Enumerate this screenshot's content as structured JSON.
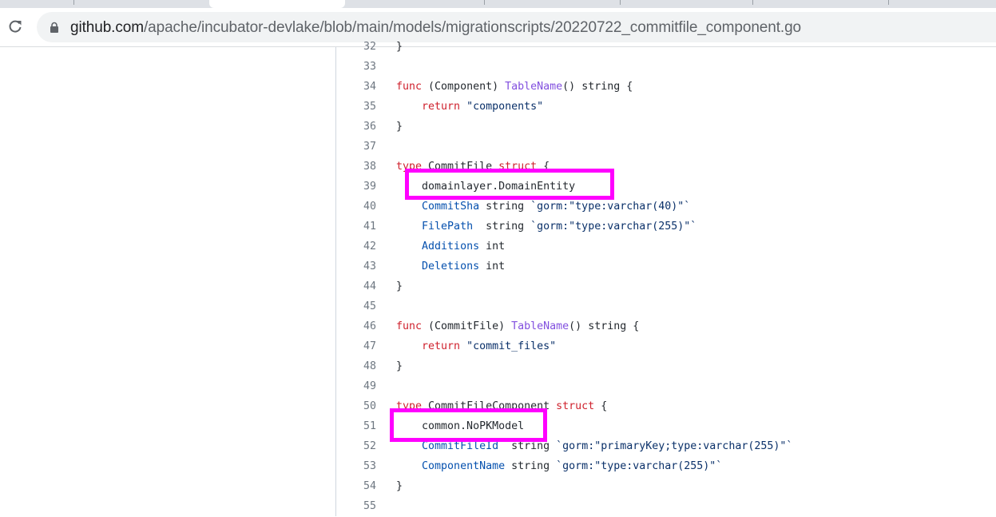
{
  "browser": {
    "url_host": "github.com",
    "url_path": "/apache/incubator-devlake/blob/main/models/migrationscripts/20220722_commitfile_component.go"
  },
  "code": {
    "lines": [
      {
        "num": "32",
        "parts": [
          {
            "t": "}",
            "c": ""
          }
        ]
      },
      {
        "num": "33",
        "parts": []
      },
      {
        "num": "34",
        "parts": [
          {
            "t": "func",
            "c": "kw"
          },
          {
            "t": " (Component) ",
            "c": ""
          },
          {
            "t": "TableName",
            "c": "fn"
          },
          {
            "t": "() string {",
            "c": ""
          }
        ]
      },
      {
        "num": "35",
        "parts": [
          {
            "t": "    ",
            "c": ""
          },
          {
            "t": "return",
            "c": "kw"
          },
          {
            "t": " ",
            "c": ""
          },
          {
            "t": "\"components\"",
            "c": "str"
          }
        ]
      },
      {
        "num": "36",
        "parts": [
          {
            "t": "}",
            "c": ""
          }
        ]
      },
      {
        "num": "37",
        "parts": []
      },
      {
        "num": "38",
        "parts": [
          {
            "t": "type",
            "c": "kw"
          },
          {
            "t": " CommitFile ",
            "c": ""
          },
          {
            "t": "struct",
            "c": "kw"
          },
          {
            "t": " {",
            "c": ""
          }
        ]
      },
      {
        "num": "39",
        "parts": [
          {
            "t": "    domainlayer.DomainEntity",
            "c": ""
          }
        ]
      },
      {
        "num": "40",
        "parts": [
          {
            "t": "    ",
            "c": ""
          },
          {
            "t": "CommitSha",
            "c": "fld"
          },
          {
            "t": " string ",
            "c": ""
          },
          {
            "t": "`gorm:\"type:varchar(40)\"`",
            "c": "str"
          }
        ]
      },
      {
        "num": "41",
        "parts": [
          {
            "t": "    ",
            "c": ""
          },
          {
            "t": "FilePath",
            "c": "fld"
          },
          {
            "t": "  string ",
            "c": ""
          },
          {
            "t": "`gorm:\"type:varchar(255)\"`",
            "c": "str"
          }
        ]
      },
      {
        "num": "42",
        "parts": [
          {
            "t": "    ",
            "c": ""
          },
          {
            "t": "Additions",
            "c": "fld"
          },
          {
            "t": " int",
            "c": ""
          }
        ]
      },
      {
        "num": "43",
        "parts": [
          {
            "t": "    ",
            "c": ""
          },
          {
            "t": "Deletions",
            "c": "fld"
          },
          {
            "t": " int",
            "c": ""
          }
        ]
      },
      {
        "num": "44",
        "parts": [
          {
            "t": "}",
            "c": ""
          }
        ]
      },
      {
        "num": "45",
        "parts": []
      },
      {
        "num": "46",
        "parts": [
          {
            "t": "func",
            "c": "kw"
          },
          {
            "t": " (CommitFile) ",
            "c": ""
          },
          {
            "t": "TableName",
            "c": "fn"
          },
          {
            "t": "() string {",
            "c": ""
          }
        ]
      },
      {
        "num": "47",
        "parts": [
          {
            "t": "    ",
            "c": ""
          },
          {
            "t": "return",
            "c": "kw"
          },
          {
            "t": " ",
            "c": ""
          },
          {
            "t": "\"commit_files\"",
            "c": "str"
          }
        ]
      },
      {
        "num": "48",
        "parts": [
          {
            "t": "}",
            "c": ""
          }
        ]
      },
      {
        "num": "49",
        "parts": []
      },
      {
        "num": "50",
        "parts": [
          {
            "t": "type",
            "c": "kw"
          },
          {
            "t": " CommitFileComponent ",
            "c": ""
          },
          {
            "t": "struct",
            "c": "kw"
          },
          {
            "t": " {",
            "c": ""
          }
        ]
      },
      {
        "num": "51",
        "parts": [
          {
            "t": "    common.NoPKModel",
            "c": ""
          }
        ]
      },
      {
        "num": "52",
        "parts": [
          {
            "t": "    ",
            "c": ""
          },
          {
            "t": "CommitFileId",
            "c": "fld"
          },
          {
            "t": "  string ",
            "c": ""
          },
          {
            "t": "`gorm:\"primaryKey;type:varchar(255)\"`",
            "c": "str"
          }
        ]
      },
      {
        "num": "53",
        "parts": [
          {
            "t": "    ",
            "c": ""
          },
          {
            "t": "ComponentName",
            "c": "fld"
          },
          {
            "t": " string ",
            "c": ""
          },
          {
            "t": "`gorm:\"type:varchar(255)\"`",
            "c": "str"
          }
        ]
      },
      {
        "num": "54",
        "parts": [
          {
            "t": "}",
            "c": ""
          }
        ]
      },
      {
        "num": "55",
        "parts": []
      }
    ]
  },
  "annotation_color": "#ff00ff"
}
